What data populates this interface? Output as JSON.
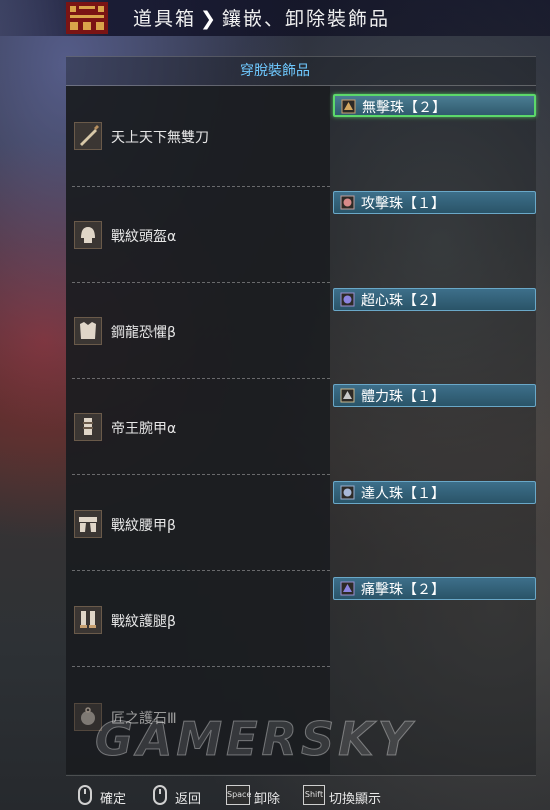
{
  "header": {
    "breadcrumb": [
      "道具箱",
      "鑲嵌、卸除裝飾品"
    ],
    "logo_icon": "hunter-emblem-icon"
  },
  "panel": {
    "title": "穿脫裝飾品"
  },
  "equipment": [
    {
      "label": "天上天下無雙刀",
      "icon": "long-sword-icon",
      "decoration": "無擊珠【２】",
      "selected": true
    },
    {
      "label": "戰紋頭盔α",
      "icon": "helmet-icon",
      "decoration": "攻擊珠【１】",
      "selected": false
    },
    {
      "label": "鋼龍恐懼β",
      "icon": "chest-armor-icon",
      "decoration": "超心珠【２】",
      "selected": false
    },
    {
      "label": "帝王腕甲α",
      "icon": "arm-armor-icon",
      "decoration": "體力珠【１】",
      "selected": false
    },
    {
      "label": "戰紋腰甲β",
      "icon": "waist-armor-icon",
      "decoration": "達人珠【１】",
      "selected": false
    },
    {
      "label": "戰紋護腿β",
      "icon": "leg-armor-icon",
      "decoration": "痛擊珠【２】",
      "selected": false
    },
    {
      "label": "匠之護石Ⅲ",
      "icon": "charm-icon",
      "decoration": null,
      "selected": false
    }
  ],
  "footer": {
    "hints": [
      {
        "key": "mouse-left",
        "label": "確定"
      },
      {
        "key": "mouse-right",
        "label": "返回"
      },
      {
        "key": "Space",
        "label": "卸除"
      },
      {
        "key": "Shift",
        "label": "切換顯示"
      }
    ]
  },
  "watermark": "GAMERSKY",
  "colors": {
    "title_blue": "#6fc9ff",
    "decoration_bg": "#2a5468",
    "selection_green": "#5cd86a"
  }
}
